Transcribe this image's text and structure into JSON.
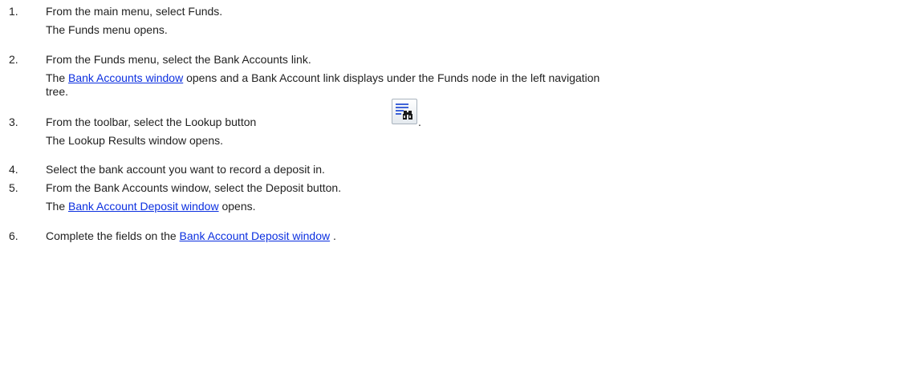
{
  "steps": [
    {
      "number": "1.",
      "text": "From the main menu, select Funds.",
      "result": "The Funds menu opens."
    },
    {
      "number": "2.",
      "text": "From the Funds menu, select the Bank Accounts link.",
      "result_prefix": "The ",
      "result_link": "Bank Accounts window",
      "result_suffix": " opens and a Bank Account link displays under the Funds node in the left navigation",
      "result_cont": "tree."
    },
    {
      "number": "3.",
      "text": "From the toolbar, select the Lookup button",
      "text_end": ".",
      "icon": "lookup-binoculars-icon",
      "result": "The Lookup Results window opens."
    },
    {
      "number": "4.",
      "text": "Select the bank account you want to record a deposit in."
    },
    {
      "number": "5.",
      "text": "From the Bank Accounts window, select the Deposit button.",
      "result_prefix": "The ",
      "result_link": "Bank Account Deposit window",
      "result_suffix": " opens."
    },
    {
      "number": "6.",
      "text_prefix": "Complete the fields on the ",
      "text_link": "Bank Account Deposit window",
      "text_suffix": " ."
    }
  ],
  "colors": {
    "text": "#222222",
    "link": "#0b2fe0",
    "icon_lines": "#3f63d8"
  }
}
